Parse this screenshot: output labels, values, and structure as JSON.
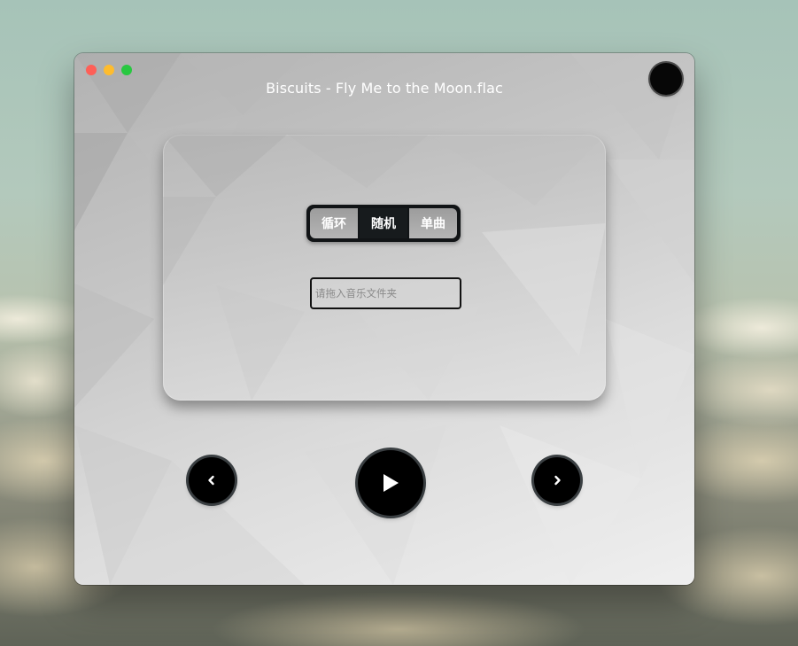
{
  "window": {
    "title": "Biscuits - Fly Me to the Moon.flac"
  },
  "mode_selector": {
    "options": [
      "循环",
      "随机",
      "单曲"
    ],
    "selected": "随机"
  },
  "folder_input": {
    "value": "",
    "placeholder": "请拖入音乐文件夹"
  },
  "controls": {
    "prev_icon": "chevron-left-icon",
    "play_icon": "play-icon",
    "next_icon": "chevron-right-icon"
  },
  "colors": {
    "close": "#fe5f57",
    "minimize": "#febc2e",
    "maximize": "#28c840",
    "button_bg": "#000000",
    "selected_segment": "#171b1d"
  }
}
